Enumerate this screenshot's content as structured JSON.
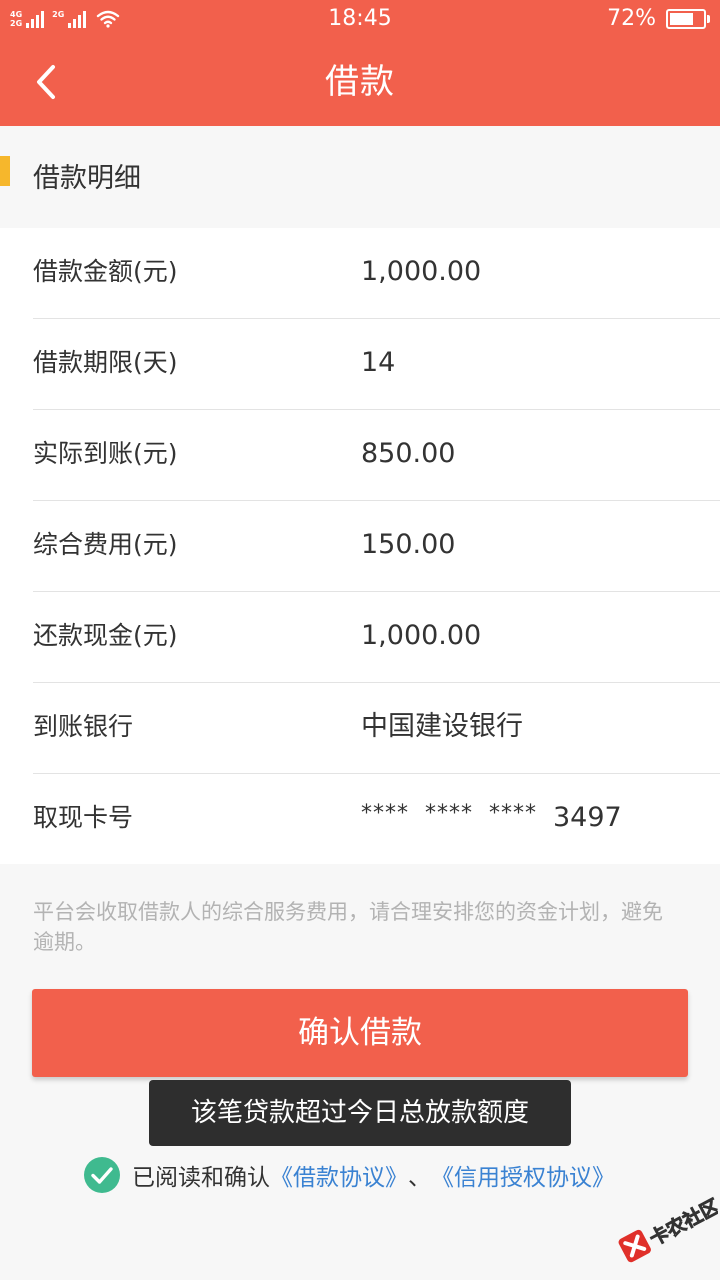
{
  "status_bar": {
    "net_top": "4G",
    "net_bottom": "2G",
    "net_second": "2G",
    "time": "18:45",
    "battery_percent": "72%",
    "battery_level": 0.72
  },
  "nav": {
    "title": "借款",
    "back_icon": "chevron-left-icon"
  },
  "section": {
    "title": "借款明细"
  },
  "details": [
    {
      "label": "借款金额(元)",
      "value": "1,000.00"
    },
    {
      "label": "借款期限(天)",
      "value": "14"
    },
    {
      "label": "实际到账(元)",
      "value": "850.00"
    },
    {
      "label": "综合费用(元)",
      "value": "150.00"
    },
    {
      "label": "还款现金(元)",
      "value": "1,000.00"
    },
    {
      "label": "到账银行",
      "value": "中国建设银行"
    },
    {
      "label": "取现卡号",
      "mask": "****  ****  ****",
      "last4": "3497"
    }
  ],
  "notice": "平台会收取借款人的综合服务费用，请合理安排您的资金计划，避免逾期。",
  "confirm_button": "确认借款",
  "toast": "该笔贷款超过今日总放款额度",
  "agreement": {
    "checked": true,
    "prefix": "已阅读和确认",
    "link1": "《借款协议》",
    "separator": "、",
    "link2": "《信用授权协议》"
  },
  "watermark": {
    "text": "卡农社区"
  },
  "colors": {
    "primary": "#f2604c",
    "accent_marker": "#f6b72c",
    "link": "#3a82d2",
    "check": "#3fba8f"
  }
}
